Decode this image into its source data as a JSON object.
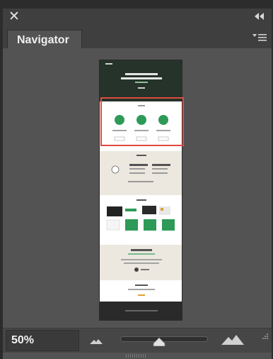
{
  "panel": {
    "title": "Navigator",
    "zoom_value": "50%",
    "zoom_slider_fraction": 0.5,
    "accent_colors": {
      "view_box": "#e04b3f",
      "site_green": "#2e9a57"
    }
  },
  "icons": {
    "close": "close-icon",
    "collapse": "double-chevron-left-icon",
    "menu": "panel-menu-icon",
    "zoom_out": "small-mountain-icon",
    "zoom_in": "large-mountain-icon",
    "resize": "resize-grip-icon"
  }
}
